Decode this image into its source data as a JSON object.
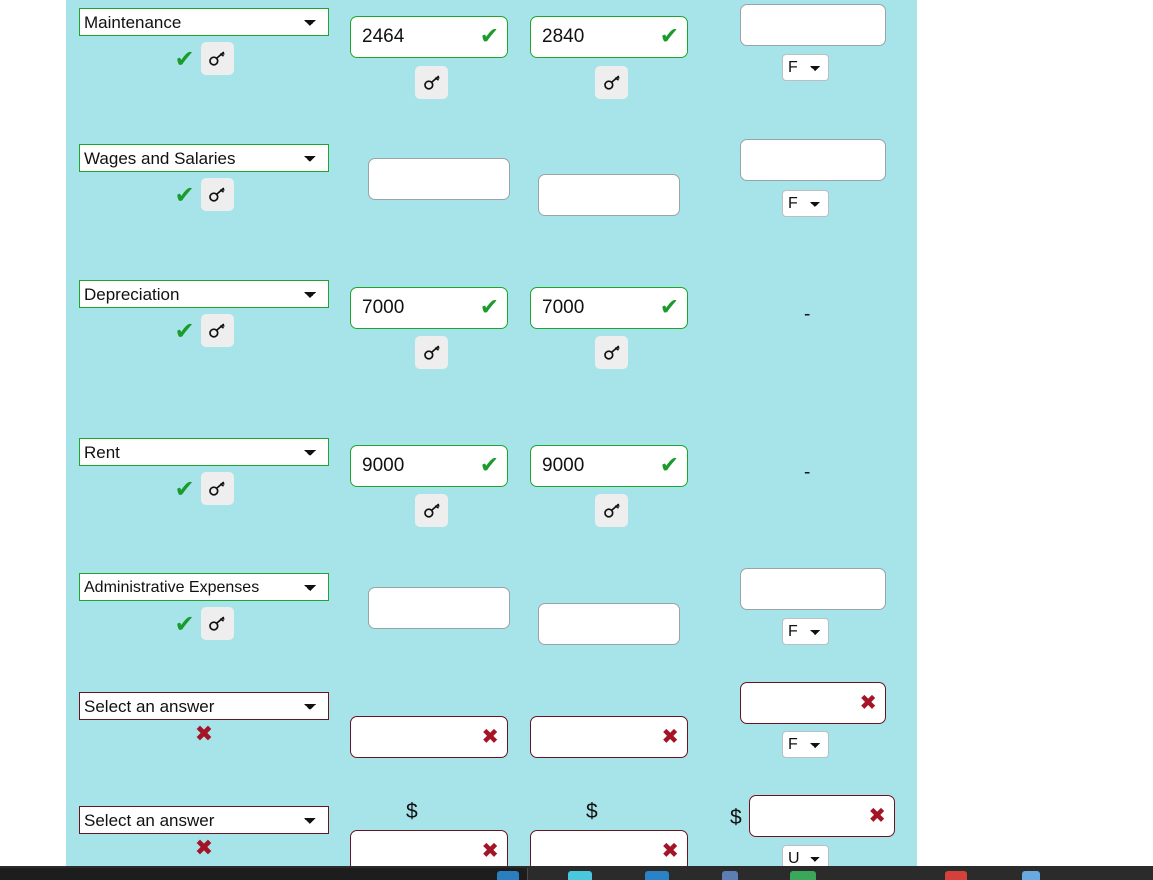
{
  "theme": {
    "panel_bg": "#a7e4ea",
    "valid_border": "#1fa52e",
    "error_border": "#6b1420",
    "tick_color": "#1b9b2c",
    "cross_color": "#a51426",
    "page_bg": "#ffffff",
    "taskbar_bg": "#2b2b2b"
  },
  "icons": {
    "key": "key-icon",
    "tick": "✔",
    "cross": "✖",
    "dollar": "$",
    "dash": "-"
  },
  "rows": [
    {
      "account": "Maintenance",
      "account_state": "valid",
      "account_mark": "✔",
      "has_key": true,
      "col2": {
        "value": "2464",
        "state": "valid",
        "mark": "✔",
        "has_key": true,
        "dollar": ""
      },
      "col3": {
        "value": "2840",
        "state": "valid",
        "mark": "✔",
        "has_key": true,
        "dollar": ""
      },
      "col4": {
        "value": "",
        "state": "neutral",
        "mark": "",
        "dollar": "",
        "fu": "F"
      }
    },
    {
      "account": "Wages and Salaries",
      "account_state": "valid",
      "account_mark": "✔",
      "has_key": true,
      "col2": {
        "value": "",
        "state": "neutral",
        "mark": "",
        "has_key": false,
        "dollar": ""
      },
      "col3": {
        "value": "",
        "state": "neutral",
        "mark": "",
        "has_key": false,
        "dollar": ""
      },
      "col4": {
        "value": "",
        "state": "neutral",
        "mark": "",
        "dollar": "",
        "fu": "F"
      }
    },
    {
      "account": "Depreciation",
      "account_state": "valid",
      "account_mark": "✔",
      "has_key": true,
      "col2": {
        "value": "7000",
        "state": "valid",
        "mark": "✔",
        "has_key": true,
        "dollar": ""
      },
      "col3": {
        "value": "7000",
        "state": "valid",
        "mark": "✔",
        "has_key": true,
        "dollar": ""
      },
      "col4": {
        "value": null,
        "state": "dash",
        "mark": "",
        "dollar": "",
        "fu": ""
      }
    },
    {
      "account": "Rent",
      "account_state": "valid",
      "account_mark": "✔",
      "has_key": true,
      "col2": {
        "value": "9000",
        "state": "valid",
        "mark": "✔",
        "has_key": true,
        "dollar": ""
      },
      "col3": {
        "value": "9000",
        "state": "valid",
        "mark": "✔",
        "has_key": true,
        "dollar": ""
      },
      "col4": {
        "value": null,
        "state": "dash",
        "mark": "",
        "dollar": "",
        "fu": ""
      }
    },
    {
      "account": "Administrative Expenses",
      "account_state": "valid",
      "account_mark": "✔",
      "has_key": true,
      "col2": {
        "value": "",
        "state": "neutral",
        "mark": "",
        "has_key": false,
        "dollar": ""
      },
      "col3": {
        "value": "",
        "state": "neutral",
        "mark": "",
        "has_key": false,
        "dollar": ""
      },
      "col4": {
        "value": "",
        "state": "neutral",
        "mark": "",
        "dollar": "",
        "fu": "F"
      }
    },
    {
      "account": "Select an answer",
      "account_state": "error",
      "account_mark": "✖",
      "has_key": false,
      "col2": {
        "value": "",
        "state": "error",
        "mark": "✖",
        "has_key": false,
        "dollar": ""
      },
      "col3": {
        "value": "",
        "state": "error",
        "mark": "✖",
        "has_key": false,
        "dollar": ""
      },
      "col4": {
        "value": "",
        "state": "error",
        "mark": "✖",
        "dollar": "",
        "fu": "F"
      }
    },
    {
      "account": "Select an answer",
      "account_state": "error",
      "account_mark": "✖",
      "has_key": false,
      "col2": {
        "value": "",
        "state": "error",
        "mark": "✖",
        "has_key": false,
        "dollar": "$"
      },
      "col3": {
        "value": "",
        "state": "error",
        "mark": "✖",
        "has_key": false,
        "dollar": "$"
      },
      "col4": {
        "value": "",
        "state": "error",
        "mark": "✖",
        "dollar": "$",
        "fu": "U"
      }
    }
  ],
  "select_options": {
    "placeholder": "Select an answer",
    "options": [
      "Select an answer",
      "Maintenance",
      "Wages and Salaries",
      "Depreciation",
      "Rent",
      "Administrative Expenses"
    ]
  },
  "fu_options": {
    "options": [
      "F",
      "U"
    ]
  }
}
